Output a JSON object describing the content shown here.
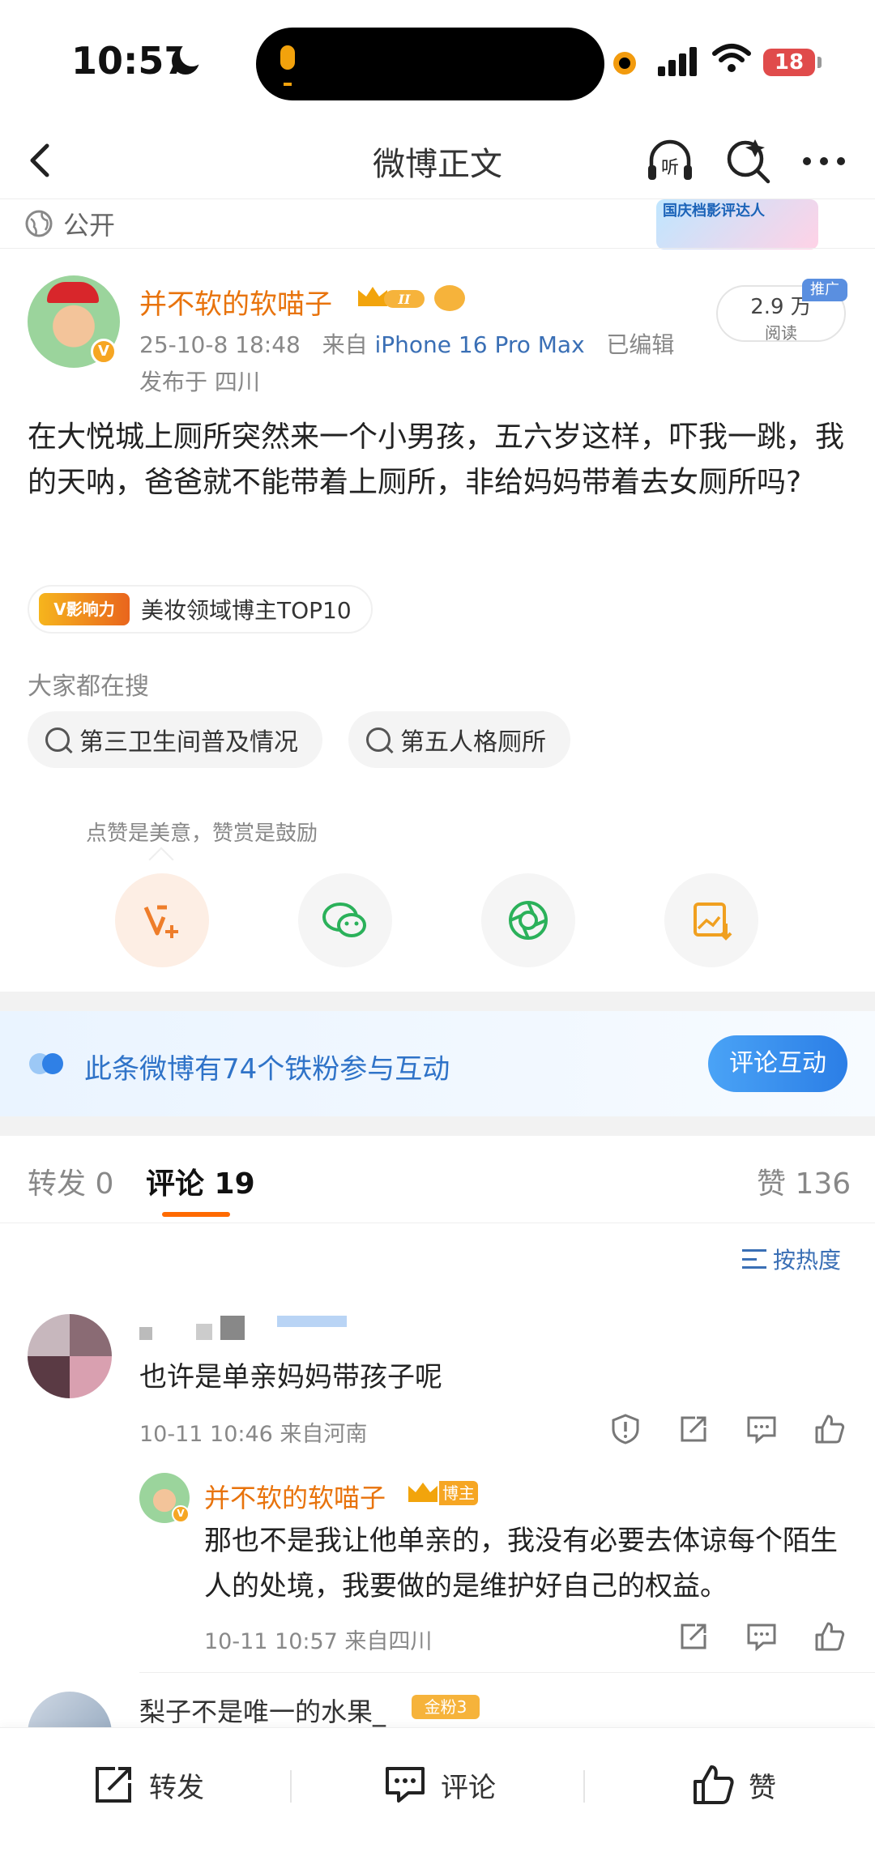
{
  "status_bar": {
    "time": "10:57",
    "battery": "18"
  },
  "nav": {
    "title": "微博正文",
    "listen_label": "听"
  },
  "visibility": "公开",
  "banner": {
    "text": "国庆档影评达人"
  },
  "post": {
    "author": "并不软的软喵子",
    "verified": "V",
    "level_badge": "II",
    "date": "25-10-8 18:48",
    "source_prefix": "来自",
    "device": "iPhone 16 Pro Max",
    "edited": "已编辑",
    "location": "发布于 四川",
    "reads": "2.9 万",
    "reads_label": "阅读",
    "promo": "推广",
    "text": "在大悦城上厕所突然来一个小男孩，五六岁这样，吓我一跳，我的天呐，爸爸就不能带着上厕所，非给妈妈带着去女厕所吗?",
    "influence_badge": "V影响力",
    "influence_text": "美妆领域博主TOP10"
  },
  "search": {
    "heading": "大家都在搜",
    "chips": [
      "第三卫生间普及情况",
      "第五人格厕所"
    ]
  },
  "actions": {
    "tip": "点赞是美意，赞赏是鼓励",
    "icons": [
      "reward-icon",
      "wechat-icon",
      "moments-icon",
      "save-image-icon"
    ]
  },
  "fans": {
    "text": "此条微博有74个铁粉参与互动",
    "button": "评论互动"
  },
  "tabs": {
    "repost": "转发 0",
    "comment": "评论 19",
    "like": "赞 136"
  },
  "sort_label": "按热度",
  "comments": [
    {
      "text": "也许是单亲妈妈带孩子呢",
      "meta": "10-11 10:46  来自河南",
      "reply": {
        "author": "并不软的软喵子",
        "badge": "博主",
        "text": "那也不是我让他单亲的，我没有必要去体谅每个陌生人的处境，我要做的是维护好自己的权益。",
        "meta": "10-11 10:57  来自四川"
      }
    },
    {
      "author": "梨子不是唯一的水果_",
      "badge": "金粉3"
    }
  ],
  "bottom_bar": {
    "repost": "转发",
    "comment": "评论",
    "like": "赞"
  },
  "colors": {
    "accent": "#ff6a00",
    "name": "#e8730c",
    "link": "#3a6fb5"
  }
}
